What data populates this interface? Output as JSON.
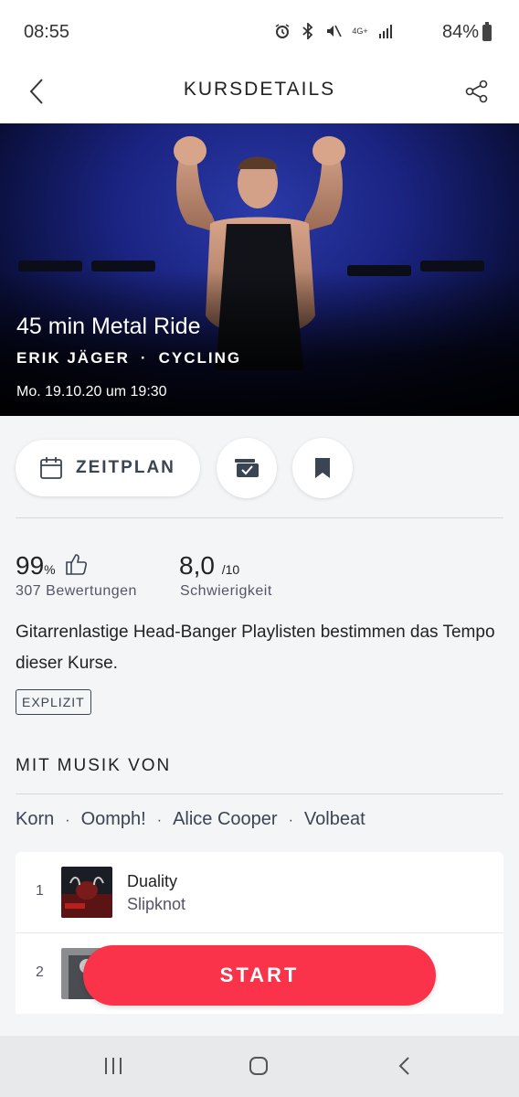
{
  "status_bar": {
    "time": "08:55",
    "network": "4G+",
    "battery": "84%"
  },
  "header": {
    "title": "KURSDETAILS"
  },
  "class": {
    "title": "45 min Metal Ride",
    "instructor": "ERIK JÄGER",
    "separator": "·",
    "category": "CYCLING",
    "datetime": "Mo. 19.10.20 um 19:30"
  },
  "actions": {
    "schedule_label": "ZEITPLAN"
  },
  "stats": {
    "rating_value": "99",
    "rating_unit": "%",
    "rating_label": "307 Bewertungen",
    "difficulty_value": "8,0",
    "difficulty_unit": "/10",
    "difficulty_label": "Schwierigkeit"
  },
  "description": "Gitarrenlastige Head-Banger Playlisten bestimmen das Tempo dieser Kurse.",
  "badge": "EXPLIZIT",
  "music": {
    "heading": "MIT MUSIK VON",
    "artists": [
      "Korn",
      "Oomph!",
      "Alice Cooper",
      "Volbeat"
    ],
    "separator": "·"
  },
  "tracks": [
    {
      "number": "1",
      "title": "Duality",
      "artist": "Slipknot"
    },
    {
      "number": "2",
      "title": "",
      "artist": ""
    }
  ],
  "start_label": "START",
  "colors": {
    "accent": "#fa324a",
    "background": "#f4f5f7",
    "text_secondary": "#3a4453"
  },
  "icons": {
    "back": "chevron-left-icon",
    "share": "share-icon",
    "calendar": "calendar-icon",
    "stack": "stack-check-icon",
    "bookmark": "bookmark-icon",
    "thumbs_up": "thumbs-up-icon"
  }
}
